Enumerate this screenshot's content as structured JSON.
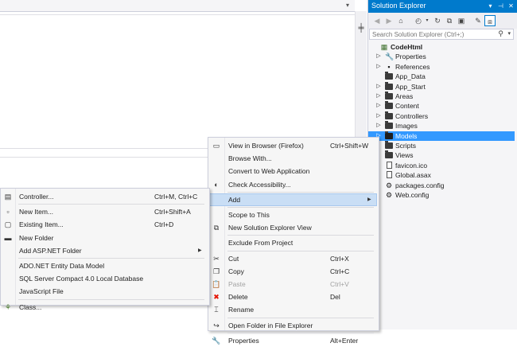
{
  "solution_explorer": {
    "title": "Solution Explorer",
    "title_buttons": [
      "chevron-down-icon",
      "pin-icon",
      "close-icon"
    ],
    "search": {
      "placeholder": "Search Solution Explorer (Ctrl+;)",
      "value": ""
    },
    "tree": [
      {
        "label": "CodeHtml",
        "icon": "project-icon",
        "expander": "",
        "bold": true
      },
      {
        "label": "Properties",
        "icon": "wrench-icon",
        "expander": "collapsed"
      },
      {
        "label": "References",
        "icon": "references-icon",
        "expander": "collapsed"
      },
      {
        "label": "App_Data",
        "icon": "folder-icon",
        "expander": ""
      },
      {
        "label": "App_Start",
        "icon": "folder-icon",
        "expander": "collapsed"
      },
      {
        "label": "Areas",
        "icon": "folder-icon",
        "expander": "collapsed"
      },
      {
        "label": "Content",
        "icon": "folder-icon",
        "expander": "collapsed"
      },
      {
        "label": "Controllers",
        "icon": "folder-icon",
        "expander": "collapsed"
      },
      {
        "label": "Images",
        "icon": "folder-icon",
        "expander": "collapsed"
      },
      {
        "label": "Models",
        "icon": "folder-icon",
        "expander": "collapsed",
        "selected": true
      },
      {
        "label": "Scripts",
        "icon": "folder-icon",
        "expander": ""
      },
      {
        "label": "Views",
        "icon": "folder-icon",
        "expander": ""
      },
      {
        "label": "favicon.ico",
        "icon": "file-icon",
        "expander": ""
      },
      {
        "label": "Global.asax",
        "icon": "file-icon",
        "expander": ""
      },
      {
        "label": "packages.config",
        "icon": "config-file-icon",
        "expander": ""
      },
      {
        "label": "Web.config",
        "icon": "config-file-icon",
        "expander": ""
      }
    ]
  },
  "context_menu": {
    "items": [
      {
        "label": "View in Browser (Firefox)",
        "shortcut": "Ctrl+Shift+W",
        "icon": "browser-icon"
      },
      {
        "label": "Browse With...",
        "shortcut": "",
        "icon": ""
      },
      {
        "label": "Convert to Web Application",
        "shortcut": "",
        "icon": ""
      },
      {
        "label": "Check Accessibility...",
        "shortcut": "",
        "icon": "accessibility-icon"
      },
      {
        "separator": true
      },
      {
        "label": "Add",
        "shortcut": "",
        "icon": "",
        "submenu": true,
        "highlighted": true
      },
      {
        "separator": true
      },
      {
        "label": "Scope to This",
        "shortcut": "",
        "icon": ""
      },
      {
        "label": "New Solution Explorer View",
        "shortcut": "",
        "icon": "new-view-icon"
      },
      {
        "separator": true
      },
      {
        "label": "Exclude From Project",
        "shortcut": "",
        "icon": ""
      },
      {
        "separator": true
      },
      {
        "label": "Cut",
        "shortcut": "Ctrl+X",
        "icon": "cut-icon"
      },
      {
        "label": "Copy",
        "shortcut": "Ctrl+C",
        "icon": "copy-icon"
      },
      {
        "label": "Paste",
        "shortcut": "Ctrl+V",
        "icon": "paste-icon",
        "disabled": true
      },
      {
        "label": "Delete",
        "shortcut": "Del",
        "icon": "delete-icon"
      },
      {
        "label": "Rename",
        "shortcut": "",
        "icon": "rename-icon"
      },
      {
        "separator": true
      },
      {
        "label": "Open Folder in File Explorer",
        "shortcut": "",
        "icon": "open-folder-icon"
      },
      {
        "separator": true
      },
      {
        "label": "Properties",
        "shortcut": "Alt+Enter",
        "icon": "wrench-icon"
      }
    ]
  },
  "add_submenu": {
    "items": [
      {
        "label": "Controller...",
        "shortcut": "Ctrl+M, Ctrl+C",
        "icon": "controller-icon"
      },
      {
        "separator": true
      },
      {
        "label": "New Item...",
        "shortcut": "Ctrl+Shift+A",
        "icon": "new-item-icon"
      },
      {
        "label": "Existing Item...",
        "shortcut": "Ctrl+D",
        "icon": "existing-item-icon"
      },
      {
        "label": "New Folder",
        "shortcut": "",
        "icon": "new-folder-icon"
      },
      {
        "label": "Add ASP.NET Folder",
        "shortcut": "",
        "icon": "",
        "submenu": true
      },
      {
        "separator": true
      },
      {
        "label": "ADO.NET Entity Data Model",
        "shortcut": "",
        "icon": ""
      },
      {
        "label": "SQL Server Compact 4.0 Local Database",
        "shortcut": "",
        "icon": ""
      },
      {
        "label": "JavaScript File",
        "shortcut": "",
        "icon": ""
      },
      {
        "separator": true
      },
      {
        "label": "Class...",
        "shortcut": "",
        "icon": "class-icon"
      }
    ]
  },
  "colors": {
    "accent": "#007acc",
    "selection": "#3399ff",
    "menu_hover": "#c9def5"
  }
}
